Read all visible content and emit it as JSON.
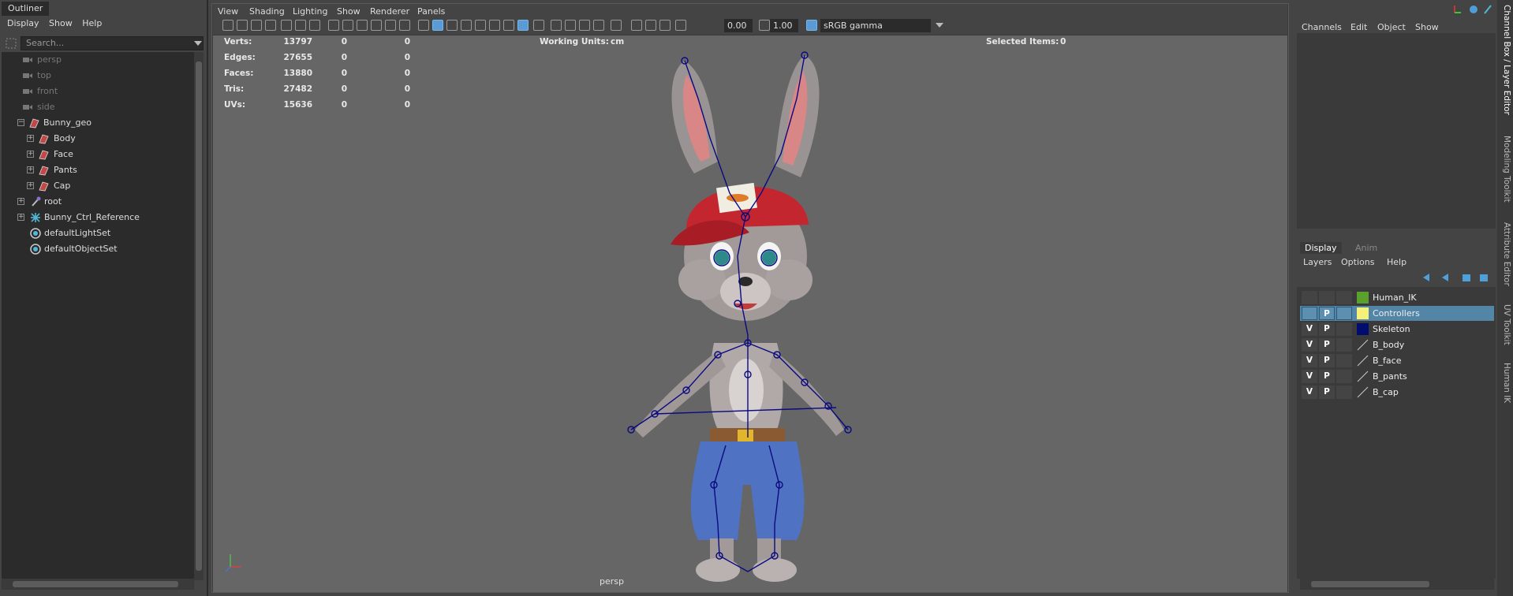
{
  "outliner": {
    "tab": "Outliner",
    "menu": [
      "Display",
      "Show",
      "Help"
    ],
    "search_placeholder": "Search...",
    "items": [
      {
        "label": "persp",
        "icon": "camera-icon"
      },
      {
        "label": "top",
        "icon": "camera-icon"
      },
      {
        "label": "front",
        "icon": "camera-icon"
      },
      {
        "label": "side",
        "icon": "camera-icon"
      },
      {
        "label": "Bunny_geo",
        "icon": "mesh-icon"
      },
      {
        "label": "Body",
        "icon": "mesh-icon"
      },
      {
        "label": "Face",
        "icon": "mesh-icon"
      },
      {
        "label": "Pants",
        "icon": "mesh-icon"
      },
      {
        "label": "Cap",
        "icon": "mesh-icon"
      },
      {
        "label": "root",
        "icon": "joint-icon"
      },
      {
        "label": "Bunny_Ctrl_Reference",
        "icon": "reference-icon"
      },
      {
        "label": "defaultLightSet",
        "icon": "set-icon"
      },
      {
        "label": "defaultObjectSet",
        "icon": "set-icon"
      }
    ]
  },
  "viewport": {
    "menu": [
      "View",
      "Shading",
      "Lighting",
      "Show",
      "Renderer",
      "Panels"
    ],
    "exposure": "0.00",
    "gamma": "1.00",
    "color_space": "sRGB gamma",
    "camera_label": "persp",
    "hud": {
      "stats": [
        {
          "label": "Verts:",
          "v1": "13797",
          "v2": "0",
          "v3": "0"
        },
        {
          "label": "Edges:",
          "v1": "27655",
          "v2": "0",
          "v3": "0"
        },
        {
          "label": "Faces:",
          "v1": "13880",
          "v2": "0",
          "v3": "0"
        },
        {
          "label": "Tris:",
          "v1": "27482",
          "v2": "0",
          "v3": "0"
        },
        {
          "label": "UVs:",
          "v1": "15636",
          "v2": "0",
          "v3": "0"
        }
      ],
      "working_units_label": "Working Units:",
      "working_units_value": "cm",
      "selected_items_label": "Selected Items:",
      "selected_items_value": "0"
    },
    "axis": {
      "x": "X",
      "y": "Y",
      "z": "Z"
    }
  },
  "channel_box": {
    "menu": [
      "Channels",
      "Edit",
      "Object",
      "Show"
    ]
  },
  "layer_editor": {
    "tabs": [
      "Display",
      "Anim"
    ],
    "active_tab": "Display",
    "menu": [
      "Layers",
      "Options",
      "Help"
    ],
    "layers": [
      {
        "name": "Human_IK",
        "v": "",
        "p": "",
        "color": "#5aa02c",
        "type": "color"
      },
      {
        "name": "Controllers",
        "v": "",
        "p": "P",
        "color": "#f5f07a",
        "type": "color",
        "selected": true
      },
      {
        "name": "Skeleton",
        "v": "V",
        "p": "P",
        "color": "#000c6e",
        "type": "color"
      },
      {
        "name": "B_body",
        "v": "V",
        "p": "P",
        "color": "",
        "type": "none"
      },
      {
        "name": "B_face",
        "v": "V",
        "p": "P",
        "color": "",
        "type": "none"
      },
      {
        "name": "B_pants",
        "v": "V",
        "p": "P",
        "color": "",
        "type": "none"
      },
      {
        "name": "B_cap",
        "v": "V",
        "p": "P",
        "color": "",
        "type": "none"
      }
    ]
  },
  "side_tabs": [
    "Channel Box / Layer Editor",
    "Modeling Toolkit",
    "Attribute Editor",
    "UV Toolkit",
    "Human IK"
  ],
  "colors": {
    "selection": "#5285a6",
    "active_icon": "#5a9bd5",
    "skeleton": "#0a0a80"
  }
}
